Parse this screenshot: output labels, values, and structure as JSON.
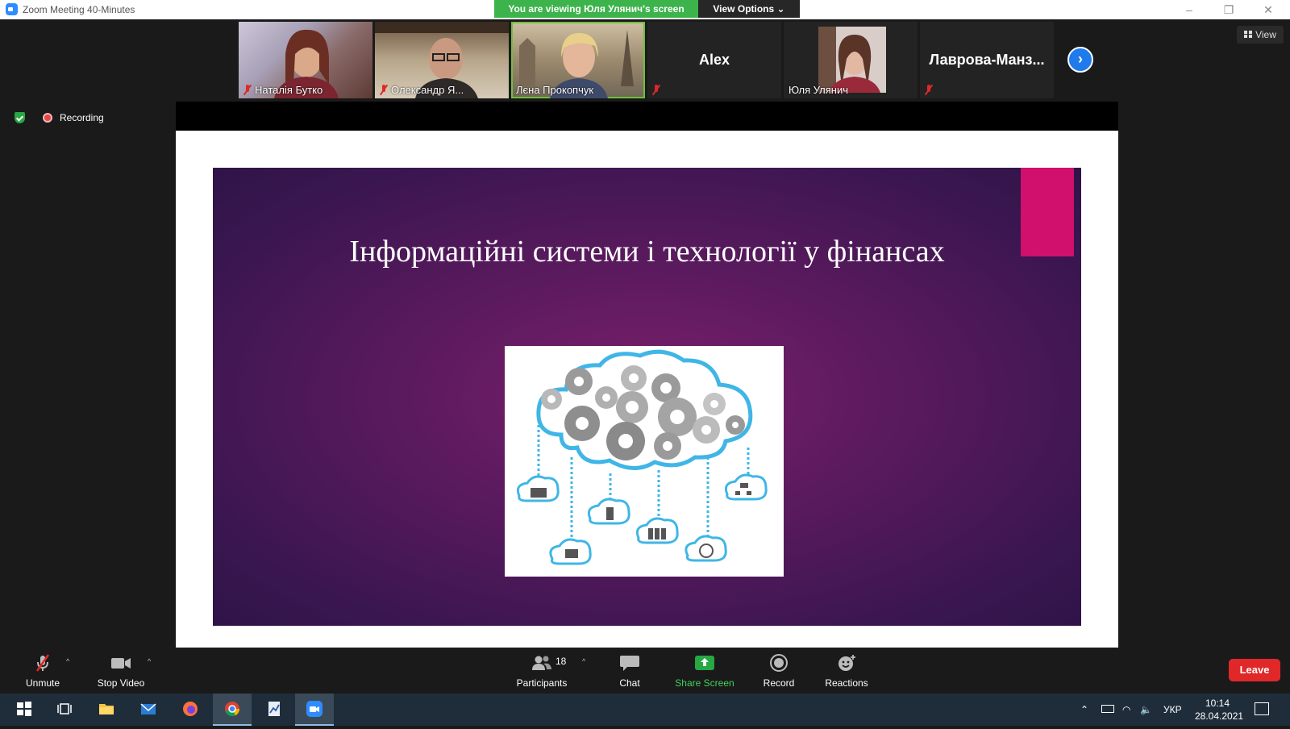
{
  "window": {
    "title": "Zoom Meeting 40-Minutes",
    "share_banner": "You are viewing Юля Улянич's screen",
    "view_options": "View Options"
  },
  "gallery": {
    "participants": [
      {
        "name": "Наталія Бутко",
        "muted": true,
        "video": true
      },
      {
        "name": "Олександр Я...",
        "muted": true,
        "video": true
      },
      {
        "name": "Лєна Прокопчук",
        "muted": false,
        "video": true,
        "active_speaker": true
      },
      {
        "name": "Alex",
        "muted": true,
        "video": false
      },
      {
        "name": "Юля Улянич",
        "muted": false,
        "video": true
      },
      {
        "name": "Лаврова-Манз...",
        "muted": true,
        "video": false
      }
    ],
    "view_label": "View"
  },
  "recording": {
    "label": "Recording"
  },
  "slide": {
    "title": "Інформаційні системи і технології у фінансах",
    "accent_color": "#d10f6d",
    "image_icon": "cloud-gears-network-icon"
  },
  "toolbar": {
    "unmute": "Unmute",
    "stop_video": "Stop Video",
    "participants": "Participants",
    "participants_count": "18",
    "chat": "Chat",
    "share_screen": "Share Screen",
    "record": "Record",
    "reactions": "Reactions",
    "leave": "Leave"
  },
  "taskbar": {
    "language": "УКР",
    "time": "10:14",
    "date": "28.04.2021"
  }
}
